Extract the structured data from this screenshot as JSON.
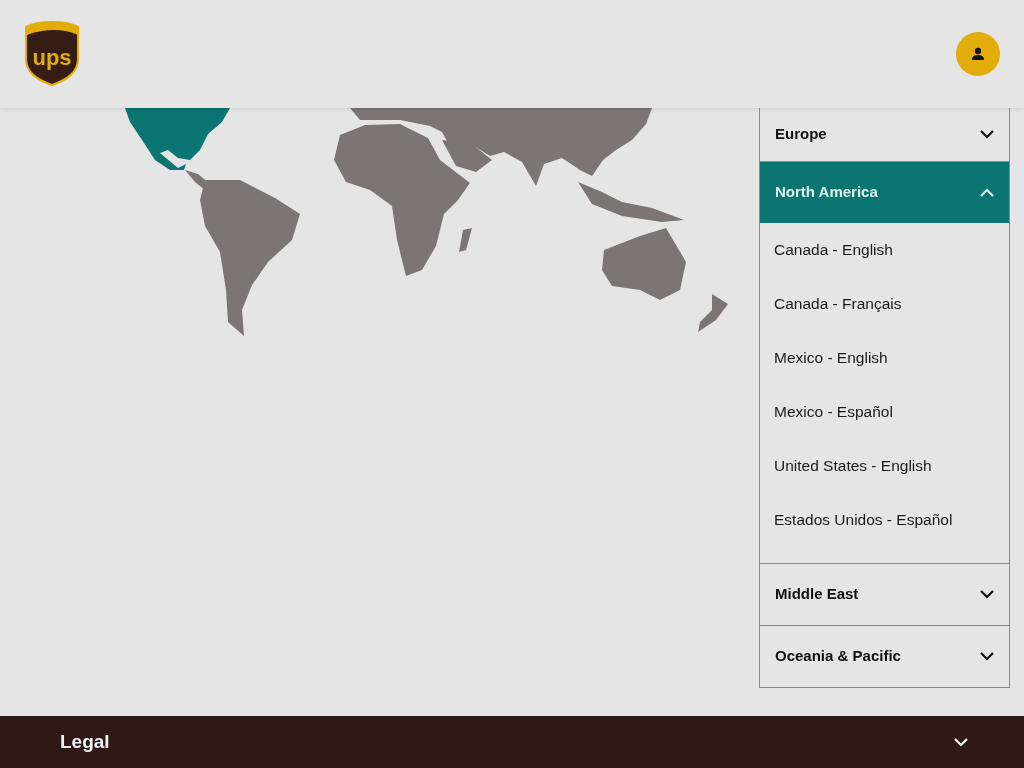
{
  "header": {
    "logo_text": "ups"
  },
  "regions": [
    {
      "title": "Europe",
      "expanded": false
    },
    {
      "title": "North America",
      "expanded": true,
      "items": [
        "Canada - English",
        "Canada - Français",
        "Mexico - English",
        "Mexico - Español",
        "United States - English",
        "Estados Unidos - Español"
      ]
    },
    {
      "title": "Middle East",
      "expanded": false
    },
    {
      "title": "Oceania & Pacific",
      "expanded": false
    }
  ],
  "footer": {
    "title": "Legal",
    "expanded": false
  }
}
